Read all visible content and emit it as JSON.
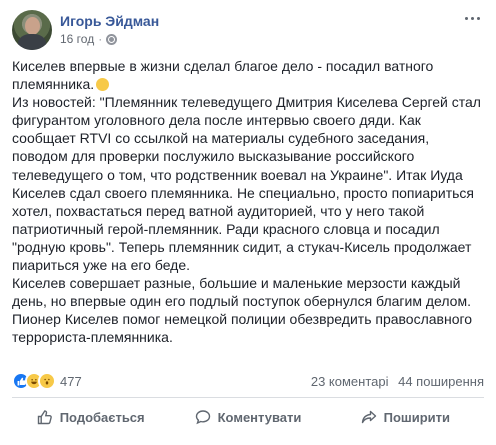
{
  "post": {
    "author": "Игорь Эйдман",
    "time": "16 год",
    "dot": "·",
    "text_lines": [
      "Киселев впервые в жизни сделал благое дело - посадил ватного",
      "племянника.",
      "Из новостей: \"Племянник телеведущего Дмитрия Киселева Сергей стал",
      "фигурантом уголовного дела после интервью своего дяди. Как",
      "сообщает RTVI со ссылкой на материалы судебного заседания,",
      "поводом для проверки послужило высказывание российского",
      "телеведущего о том, что родственник воевал на Украине\". Итак Иуда",
      "Киселев сдал своего племянника. Не специально, просто попиариться",
      "хотел, похвастаться перед ватной аудиторией, что у него такой",
      "патриотичный герой-племянник. Ради красного словца и посадил",
      "\"родную кровь\". Теперь племянник сидит, а стукач-Кисель продолжает",
      "пиариться уже на его беде.",
      "Киселев совершает разные, большие и маленькие мерзости каждый",
      "день, но впервые один его подлый поступок обернулся благим делом.",
      "Пионер Киселев помог немецкой полиции обезвредить православного",
      "террориста-племянника."
    ],
    "reactions_count": "477",
    "comments": "23 коментарі",
    "shares": "44 поширення",
    "icons": [
      "globe-icon",
      "more-icon",
      "like-icon",
      "haha-icon",
      "wow-icon",
      "comment-icon",
      "share-icon"
    ]
  },
  "actions": {
    "like": "Подобається",
    "comment": "Коментувати",
    "share": "Поширити"
  },
  "colors": {
    "author": "#385898",
    "like": "#1877f2",
    "muted": "#606770"
  }
}
